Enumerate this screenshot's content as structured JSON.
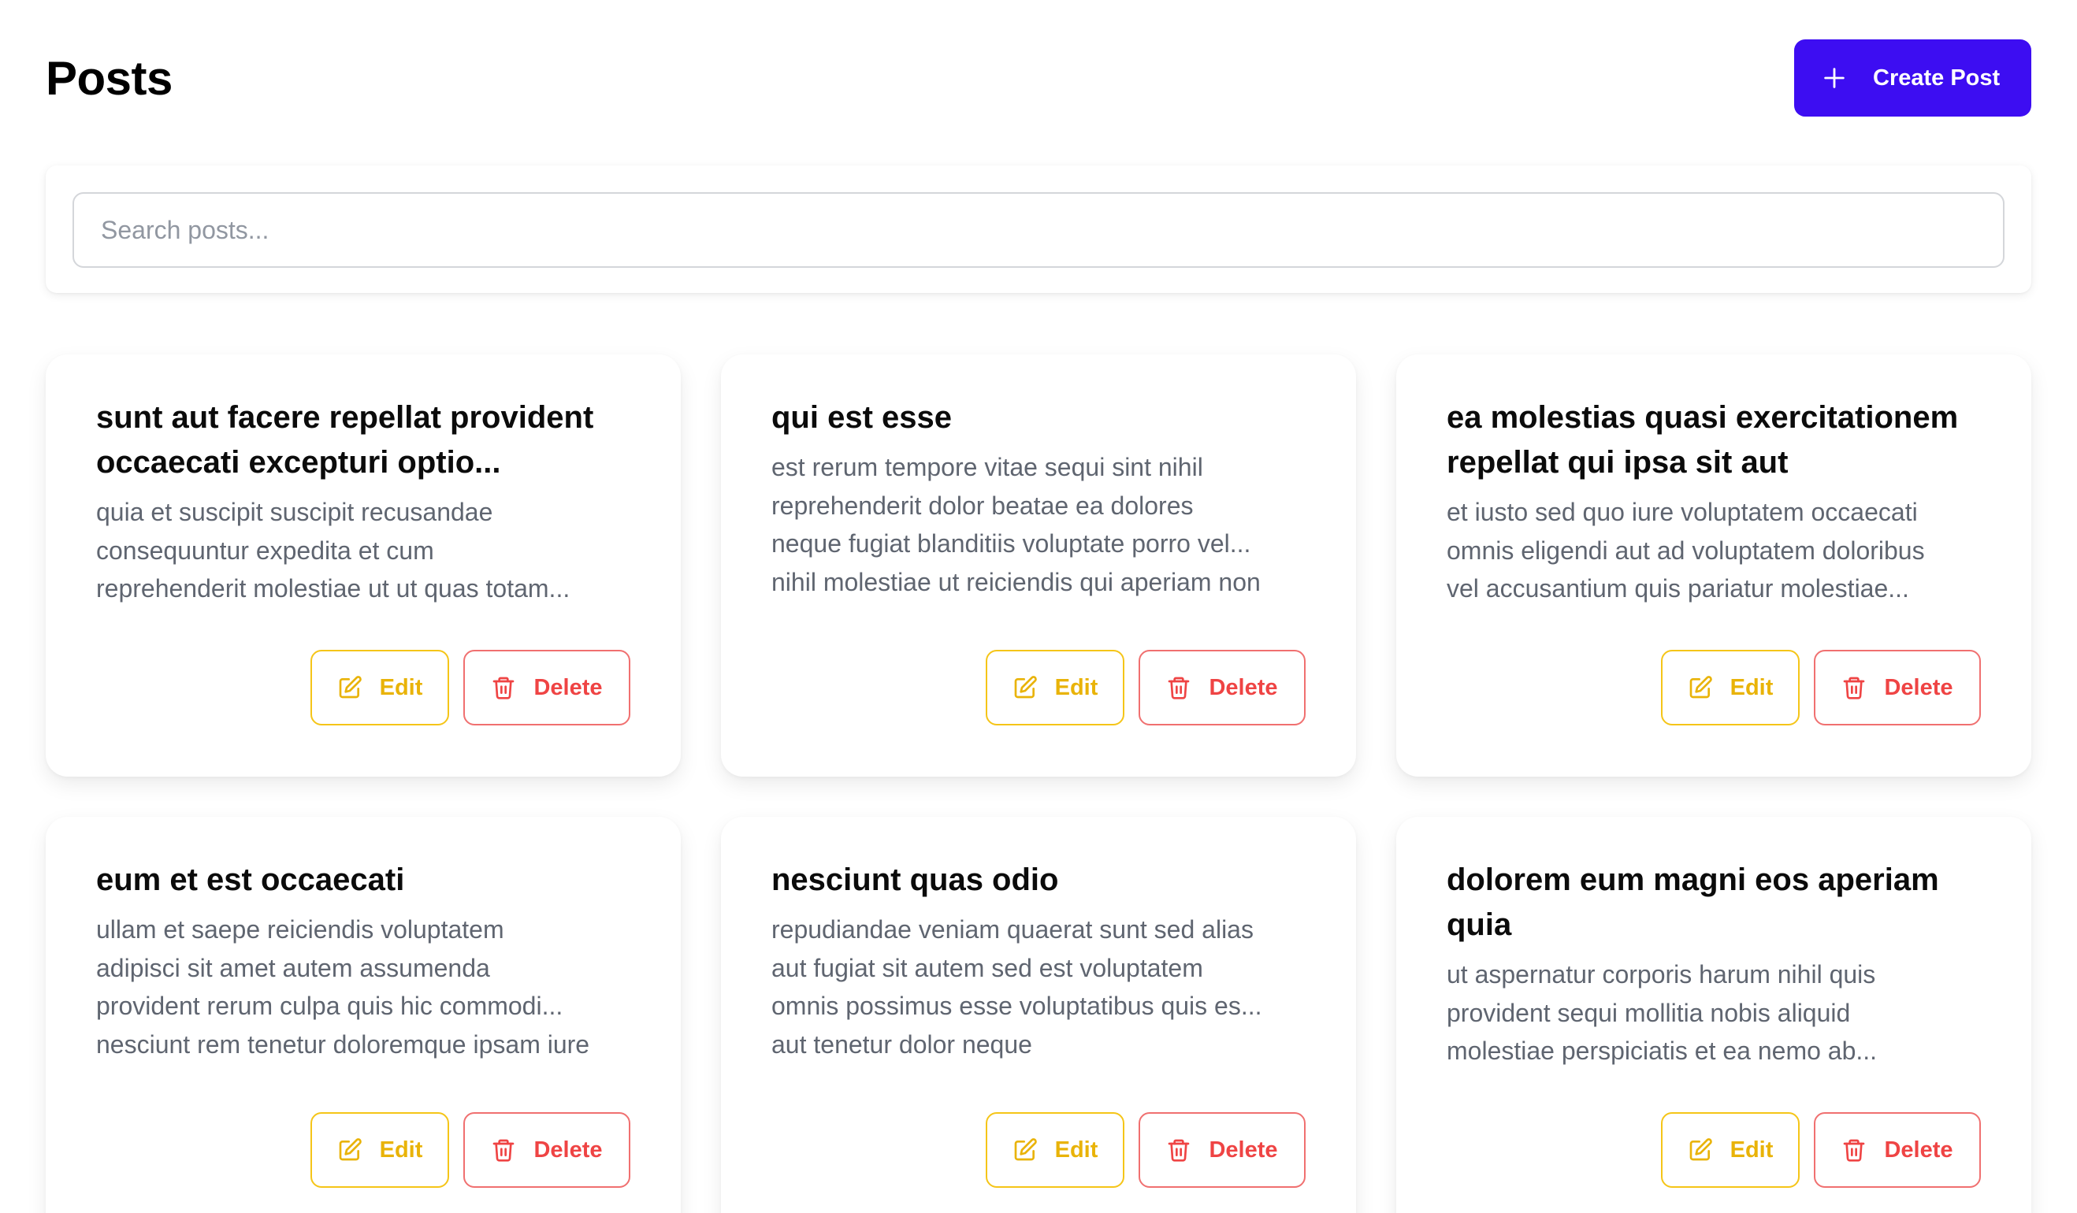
{
  "header": {
    "title": "Posts",
    "create_button_label": "Create Post",
    "create_button_icon": "plus-icon"
  },
  "search": {
    "placeholder": "Search posts...",
    "value": ""
  },
  "colors": {
    "primary": "#3d0df2",
    "edit": "#e9b308",
    "delete": "#ef4444",
    "body_text": "#5f6570"
  },
  "posts": [
    {
      "title": "sunt aut facere repellat provident occaecati excepturi optio...",
      "body": "quia et suscipit suscipit recusandae\nconsequuntur expedita et cum\nreprehenderit molestiae ut ut quas totam...",
      "edit_label": "Edit",
      "delete_label": "Delete"
    },
    {
      "title": "qui est esse",
      "body": "est rerum tempore vitae sequi sint nihil\nreprehenderit dolor beatae ea dolores\nneque fugiat blanditiis voluptate porro vel...\nnihil molestiae ut reiciendis qui aperiam non",
      "edit_label": "Edit",
      "delete_label": "Delete"
    },
    {
      "title": "ea molestias quasi exercitationem repellat qui ipsa sit aut",
      "body": "et iusto sed quo iure voluptatem occaecati\nomnis eligendi aut ad voluptatem doloribus\nvel accusantium quis pariatur molestiae...",
      "edit_label": "Edit",
      "delete_label": "Delete"
    },
    {
      "title": "eum et est occaecati",
      "body": "ullam et saepe reiciendis voluptatem\nadipisci sit amet autem assumenda\nprovident rerum culpa quis hic commodi...\nnesciunt rem tenetur doloremque ipsam iure",
      "edit_label": "Edit",
      "delete_label": "Delete"
    },
    {
      "title": "nesciunt quas odio",
      "body": "repudiandae veniam quaerat sunt sed alias\naut fugiat sit autem sed est voluptatem\nomnis possimus esse voluptatibus quis es...\naut tenetur dolor neque",
      "edit_label": "Edit",
      "delete_label": "Delete"
    },
    {
      "title": "dolorem eum magni eos aperiam quia",
      "body": "ut aspernatur corporis harum nihil quis\nprovident sequi mollitia nobis aliquid\nmolestiae perspiciatis et ea nemo ab...",
      "edit_label": "Edit",
      "delete_label": "Delete"
    }
  ]
}
